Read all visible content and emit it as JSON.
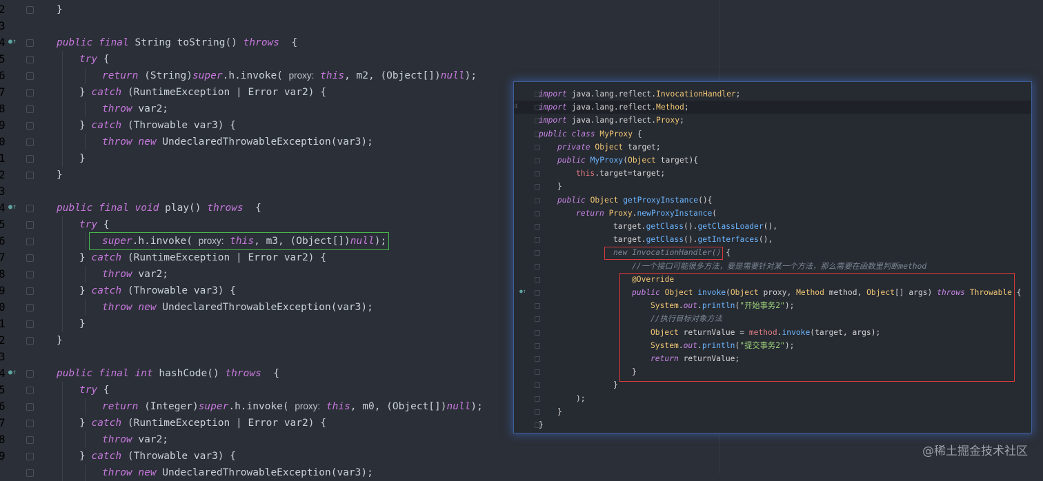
{
  "editor": {
    "line_numbers": [
      "2",
      "3",
      "4",
      "5",
      "6",
      "7",
      "8",
      "9",
      "0",
      "1",
      "2",
      "3",
      "4",
      "5",
      "6",
      "7",
      "8",
      "9",
      "0",
      "1",
      "2",
      "3",
      "4",
      "5",
      "6",
      "7",
      "8",
      "9"
    ],
    "lines": [
      {
        "segments": [
          {
            "t": "}",
            "c": ""
          }
        ],
        "indent": 0
      },
      {
        "segments": [],
        "indent": 0
      },
      {
        "segments": [
          {
            "t": "public final ",
            "c": "kw"
          },
          {
            "t": "String toString() ",
            "c": ""
          },
          {
            "t": "throws",
            "c": "kw"
          },
          {
            "t": "  {",
            "c": ""
          }
        ],
        "indent": 0
      },
      {
        "segments": [
          {
            "t": "try",
            "c": "kw"
          },
          {
            "t": " {",
            "c": ""
          }
        ],
        "indent": 1
      },
      {
        "segments": [
          {
            "t": "return ",
            "c": "kw"
          },
          {
            "t": "(String)",
            "c": ""
          },
          {
            "t": "super",
            "c": "kw"
          },
          {
            "t": ".h.invoke( ",
            "c": ""
          },
          {
            "t": "proxy:",
            "c": "hint"
          },
          {
            "t": " ",
            "c": ""
          },
          {
            "t": "this",
            "c": "kw"
          },
          {
            "t": ", m2, (Object[])",
            "c": ""
          },
          {
            "t": "null",
            "c": "kw"
          },
          {
            "t": ");",
            "c": ""
          }
        ],
        "indent": 2
      },
      {
        "segments": [
          {
            "t": "} ",
            "c": ""
          },
          {
            "t": "catch",
            "c": "kw"
          },
          {
            "t": " (RuntimeException | Error var2) {",
            "c": ""
          }
        ],
        "indent": 1
      },
      {
        "segments": [
          {
            "t": "throw",
            "c": "kw"
          },
          {
            "t": " var2;",
            "c": ""
          }
        ],
        "indent": 2
      },
      {
        "segments": [
          {
            "t": "} ",
            "c": ""
          },
          {
            "t": "catch",
            "c": "kw"
          },
          {
            "t": " (Throwable var3) {",
            "c": ""
          }
        ],
        "indent": 1
      },
      {
        "segments": [
          {
            "t": "throw new",
            "c": "kw"
          },
          {
            "t": " UndeclaredThrowableException(var3);",
            "c": ""
          }
        ],
        "indent": 2
      },
      {
        "segments": [
          {
            "t": "}",
            "c": ""
          }
        ],
        "indent": 1
      },
      {
        "segments": [
          {
            "t": "}",
            "c": ""
          }
        ],
        "indent": 0
      },
      {
        "segments": [],
        "indent": 0
      },
      {
        "segments": [
          {
            "t": "public final void ",
            "c": "kw"
          },
          {
            "t": "play() ",
            "c": ""
          },
          {
            "t": "throws",
            "c": "kw"
          },
          {
            "t": "  {",
            "c": ""
          }
        ],
        "indent": 0
      },
      {
        "segments": [
          {
            "t": "try",
            "c": "kw"
          },
          {
            "t": " {",
            "c": ""
          }
        ],
        "indent": 1
      },
      {
        "segments": [
          {
            "t": "super",
            "c": "kw"
          },
          {
            "t": ".h.invoke( ",
            "c": ""
          },
          {
            "t": "proxy:",
            "c": "hint"
          },
          {
            "t": " ",
            "c": ""
          },
          {
            "t": "this",
            "c": "kw"
          },
          {
            "t": ", m3, (Object[])",
            "c": ""
          },
          {
            "t": "null",
            "c": "kw"
          },
          {
            "t": ");",
            "c": ""
          }
        ],
        "indent": 2
      },
      {
        "segments": [
          {
            "t": "} ",
            "c": ""
          },
          {
            "t": "catch",
            "c": "kw"
          },
          {
            "t": " (RuntimeException | Error var2) {",
            "c": ""
          }
        ],
        "indent": 1
      },
      {
        "segments": [
          {
            "t": "throw",
            "c": "kw"
          },
          {
            "t": " var2;",
            "c": ""
          }
        ],
        "indent": 2
      },
      {
        "segments": [
          {
            "t": "} ",
            "c": ""
          },
          {
            "t": "catch",
            "c": "kw"
          },
          {
            "t": " (Throwable var3) {",
            "c": ""
          }
        ],
        "indent": 1
      },
      {
        "segments": [
          {
            "t": "throw new",
            "c": "kw"
          },
          {
            "t": " UndeclaredThrowableException(var3);",
            "c": ""
          }
        ],
        "indent": 2
      },
      {
        "segments": [
          {
            "t": "}",
            "c": ""
          }
        ],
        "indent": 1
      },
      {
        "segments": [
          {
            "t": "}",
            "c": ""
          }
        ],
        "indent": 0
      },
      {
        "segments": [],
        "indent": 0
      },
      {
        "segments": [
          {
            "t": "public final int ",
            "c": "kw"
          },
          {
            "t": "hashCode() ",
            "c": ""
          },
          {
            "t": "throws",
            "c": "kw"
          },
          {
            "t": "  {",
            "c": ""
          }
        ],
        "indent": 0
      },
      {
        "segments": [
          {
            "t": "try",
            "c": "kw"
          },
          {
            "t": " {",
            "c": ""
          }
        ],
        "indent": 1
      },
      {
        "segments": [
          {
            "t": "return ",
            "c": "kw"
          },
          {
            "t": "(Integer)",
            "c": ""
          },
          {
            "t": "super",
            "c": "kw"
          },
          {
            "t": ".h.invoke( ",
            "c": ""
          },
          {
            "t": "proxy:",
            "c": "hint"
          },
          {
            "t": " ",
            "c": ""
          },
          {
            "t": "this",
            "c": "kw"
          },
          {
            "t": ", m0, (Object[])",
            "c": ""
          },
          {
            "t": "null",
            "c": "kw"
          },
          {
            "t": ");",
            "c": ""
          }
        ],
        "indent": 2
      },
      {
        "segments": [
          {
            "t": "} ",
            "c": ""
          },
          {
            "t": "catch",
            "c": "kw"
          },
          {
            "t": " (RuntimeException | Error var2) {",
            "c": ""
          }
        ],
        "indent": 1
      },
      {
        "segments": [
          {
            "t": "throw",
            "c": "kw"
          },
          {
            "t": " var2;",
            "c": ""
          }
        ],
        "indent": 2
      },
      {
        "segments": [
          {
            "t": "} ",
            "c": ""
          },
          {
            "t": "catch",
            "c": "kw"
          },
          {
            "t": " (Throwable var3) {",
            "c": ""
          }
        ],
        "indent": 1
      },
      {
        "segments": [
          {
            "t": "throw new",
            "c": "kw"
          },
          {
            "t": " UndeclaredThrowableException(var3);",
            "c": ""
          }
        ],
        "indent": 2
      }
    ]
  },
  "overlay": {
    "line_numbers": [
      "",
      "4",
      "",
      "",
      "",
      "",
      "",
      "",
      "",
      "",
      "",
      "",
      "",
      "",
      "",
      "",
      "",
      "",
      "",
      "",
      "",
      "",
      "",
      "",
      "",
      "",
      ""
    ],
    "lines": [
      {
        "segments": [
          {
            "t": "import",
            "c": "ok"
          },
          {
            "t": " java.lang.reflect.",
            "c": ""
          },
          {
            "t": "InvocationHandler",
            "c": "ot"
          },
          {
            "t": ";",
            "c": ""
          }
        ],
        "indent": 0
      },
      {
        "segments": [
          {
            "t": "import",
            "c": "ok"
          },
          {
            "t": " java.lang.reflect.",
            "c": ""
          },
          {
            "t": "Method",
            "c": "ot"
          },
          {
            "t": ";",
            "c": ""
          }
        ],
        "indent": 0
      },
      {
        "segments": [
          {
            "t": "import",
            "c": "ok"
          },
          {
            "t": " java.lang.reflect.",
            "c": ""
          },
          {
            "t": "Proxy",
            "c": "ot"
          },
          {
            "t": ";",
            "c": ""
          }
        ],
        "indent": 0
      },
      {
        "segments": [
          {
            "t": "public class ",
            "c": "ok"
          },
          {
            "t": "MyProxy",
            "c": "ot"
          },
          {
            "t": " {",
            "c": ""
          }
        ],
        "indent": 0
      },
      {
        "segments": [
          {
            "t": "private ",
            "c": "ok"
          },
          {
            "t": "Object",
            "c": "ot"
          },
          {
            "t": " target;",
            "c": ""
          }
        ],
        "indent": 1
      },
      {
        "segments": [
          {
            "t": "public ",
            "c": "ok"
          },
          {
            "t": "MyProxy",
            "c": "om"
          },
          {
            "t": "(",
            "c": ""
          },
          {
            "t": "Object",
            "c": "ot"
          },
          {
            "t": " target){",
            "c": ""
          }
        ],
        "indent": 1
      },
      {
        "segments": [
          {
            "t": "this",
            "c": "on"
          },
          {
            "t": ".target=target;",
            "c": ""
          }
        ],
        "indent": 2
      },
      {
        "segments": [
          {
            "t": "}",
            "c": ""
          }
        ],
        "indent": 1
      },
      {
        "segments": [
          {
            "t": "public ",
            "c": "ok"
          },
          {
            "t": "Object",
            "c": "ot"
          },
          {
            "t": " ",
            "c": ""
          },
          {
            "t": "getProxyInstance",
            "c": "om"
          },
          {
            "t": "(){",
            "c": ""
          }
        ],
        "indent": 1
      },
      {
        "segments": [
          {
            "t": "return ",
            "c": "ok"
          },
          {
            "t": "Proxy",
            "c": "ot"
          },
          {
            "t": ".",
            "c": ""
          },
          {
            "t": "newProxyInstance",
            "c": "om"
          },
          {
            "t": "(",
            "c": ""
          }
        ],
        "indent": 2
      },
      {
        "segments": [
          {
            "t": "target.",
            "c": ""
          },
          {
            "t": "getClass",
            "c": "om"
          },
          {
            "t": "().",
            "c": ""
          },
          {
            "t": "getClassLoader",
            "c": "om"
          },
          {
            "t": "(),",
            "c": ""
          }
        ],
        "indent": 4
      },
      {
        "segments": [
          {
            "t": "target.",
            "c": ""
          },
          {
            "t": "getClass",
            "c": "om"
          },
          {
            "t": "().",
            "c": ""
          },
          {
            "t": "getInterfaces",
            "c": "om"
          },
          {
            "t": "(),",
            "c": ""
          }
        ],
        "indent": 4
      },
      {
        "segments": [
          {
            "t": "new InvocationHandler()",
            "c": "oc"
          },
          {
            "t": " {",
            "c": ""
          }
        ],
        "indent": 4
      },
      {
        "segments": [
          {
            "t": "//一个接口可能很多方法，要是需要针对某一个方法，那么需要在函数里判断method",
            "c": "oc"
          }
        ],
        "indent": 5
      },
      {
        "segments": [
          {
            "t": "@Override",
            "c": "ot"
          }
        ],
        "indent": 5
      },
      {
        "segments": [
          {
            "t": "public ",
            "c": "ok"
          },
          {
            "t": "Object",
            "c": "ot"
          },
          {
            "t": " ",
            "c": ""
          },
          {
            "t": "invoke",
            "c": "om"
          },
          {
            "t": "(",
            "c": ""
          },
          {
            "t": "Object",
            "c": "ot"
          },
          {
            "t": " proxy, ",
            "c": ""
          },
          {
            "t": "Method",
            "c": "ot"
          },
          {
            "t": " method, ",
            "c": ""
          },
          {
            "t": "Object",
            "c": "ot"
          },
          {
            "t": "[] args) ",
            "c": ""
          },
          {
            "t": "throws ",
            "c": "ok"
          },
          {
            "t": "Throwable",
            "c": "ot"
          },
          {
            "t": " {",
            "c": ""
          }
        ],
        "indent": 5
      },
      {
        "segments": [
          {
            "t": "System",
            "c": "ot"
          },
          {
            "t": ".",
            "c": ""
          },
          {
            "t": "out",
            "c": "ok"
          },
          {
            "t": ".",
            "c": ""
          },
          {
            "t": "println",
            "c": "om"
          },
          {
            "t": "(",
            "c": ""
          },
          {
            "t": "\"开始事务2\"",
            "c": "os"
          },
          {
            "t": ");",
            "c": ""
          }
        ],
        "indent": 6
      },
      {
        "segments": [
          {
            "t": "//执行目标对象方法",
            "c": "oc"
          }
        ],
        "indent": 6
      },
      {
        "segments": [
          {
            "t": "Object",
            "c": "ot"
          },
          {
            "t": " returnValue = ",
            "c": ""
          },
          {
            "t": "method",
            "c": "on"
          },
          {
            "t": ".",
            "c": ""
          },
          {
            "t": "invoke",
            "c": "om"
          },
          {
            "t": "(target, args);",
            "c": ""
          }
        ],
        "indent": 6
      },
      {
        "segments": [
          {
            "t": "System",
            "c": "ot"
          },
          {
            "t": ".",
            "c": ""
          },
          {
            "t": "out",
            "c": "ok"
          },
          {
            "t": ".",
            "c": ""
          },
          {
            "t": "println",
            "c": "om"
          },
          {
            "t": "(",
            "c": ""
          },
          {
            "t": "\"提交事务2\"",
            "c": "os"
          },
          {
            "t": ");",
            "c": ""
          }
        ],
        "indent": 6
      },
      {
        "segments": [
          {
            "t": "return ",
            "c": "ok"
          },
          {
            "t": "returnValue;",
            "c": ""
          }
        ],
        "indent": 6
      },
      {
        "segments": [
          {
            "t": "}",
            "c": ""
          }
        ],
        "indent": 5
      },
      {
        "segments": [
          {
            "t": "}",
            "c": ""
          }
        ],
        "indent": 4
      },
      {
        "segments": [
          {
            "t": ");",
            "c": ""
          }
        ],
        "indent": 2
      },
      {
        "segments": [
          {
            "t": "}",
            "c": ""
          }
        ],
        "indent": 1
      },
      {
        "segments": [
          {
            "t": "}",
            "c": ""
          }
        ],
        "indent": 0
      }
    ]
  },
  "watermark": "@稀土掘金技术社区",
  "colors": {
    "background": "#2b2f37",
    "keyword": "#c679dd",
    "highlight_green": "#49b84d",
    "highlight_red": "#d93a3a",
    "overlay_border": "#3f5f98"
  }
}
